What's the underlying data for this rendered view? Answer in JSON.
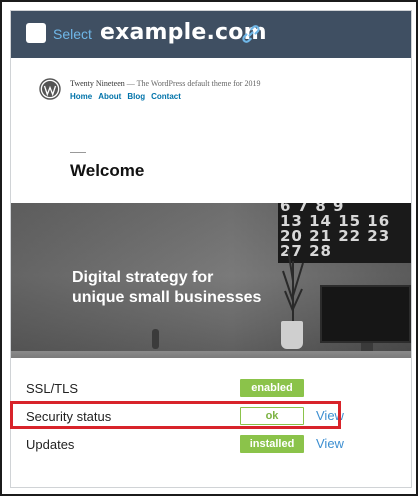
{
  "header": {
    "select_label": "Select",
    "domain": "example.com",
    "link_icon": "link-icon",
    "background_color": "#3f4f62"
  },
  "preview": {
    "site_title": "Twenty Nineteen",
    "site_tagline": " — The WordPress default theme for 2019",
    "nav": [
      "Home",
      "About",
      "Blog",
      "Contact"
    ],
    "page_heading": "Welcome",
    "hero_line_1": "Digital strategy for",
    "hero_line_2": "unique small businesses",
    "calendar_rows": [
      "6 7 8 9",
      "13 14 15 16",
      "20 21 22 23",
      "27 28"
    ]
  },
  "status": {
    "rows": [
      {
        "label": "SSL/TLS",
        "badge": "enabled",
        "badge_style": "filled",
        "view": ""
      },
      {
        "label": "Security status",
        "badge": "ok",
        "badge_style": "outline",
        "view": "View"
      },
      {
        "label": "Updates",
        "badge": "installed",
        "badge_style": "filled",
        "view": "View"
      }
    ],
    "accent_green": "#8bc34a",
    "link_blue": "#3d8fd1",
    "highlight_red": "#d8232a"
  }
}
